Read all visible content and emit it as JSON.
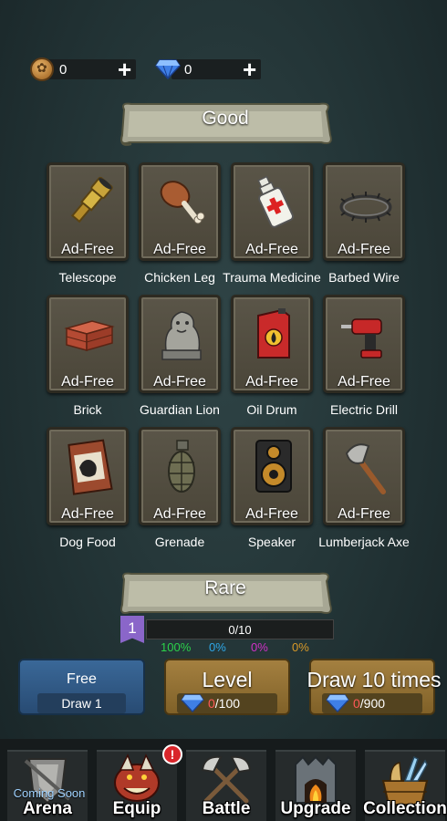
{
  "currency": {
    "coins": {
      "icon": "coin-icon",
      "value": "0",
      "add": "+"
    },
    "gems": {
      "icon": "diamond-icon",
      "value": "0",
      "add": "+"
    }
  },
  "good_banner": "Good",
  "rare_banner": "Rare",
  "items": [
    {
      "label": "Ad-Free",
      "name": "Telescope",
      "icon": "telescope-icon"
    },
    {
      "label": "Ad-Free",
      "name": "Chicken Leg",
      "icon": "chicken-leg-icon"
    },
    {
      "label": "Ad-Free",
      "name": "Trauma Medicine",
      "icon": "medicine-bottle-icon"
    },
    {
      "label": "Ad-Free",
      "name": "Barbed Wire",
      "icon": "barbed-wire-icon"
    },
    {
      "label": "Ad-Free",
      "name": "Brick",
      "icon": "brick-icon"
    },
    {
      "label": "Ad-Free",
      "name": "Guardian Lion",
      "icon": "lion-statue-icon"
    },
    {
      "label": "Ad-Free",
      "name": "Oil Drum",
      "icon": "oil-drum-icon"
    },
    {
      "label": "Ad-Free",
      "name": "Electric Drill",
      "icon": "drill-icon"
    },
    {
      "label": "Ad-Free",
      "name": "Dog Food",
      "icon": "dog-food-icon"
    },
    {
      "label": "Ad-Free",
      "name": "Grenade",
      "icon": "grenade-icon"
    },
    {
      "label": "Ad-Free",
      "name": "Speaker",
      "icon": "speaker-icon"
    },
    {
      "label": "Ad-Free",
      "name": "Lumberjack Axe",
      "icon": "axe-icon"
    }
  ],
  "progress": {
    "level": "1",
    "text": "0/10",
    "fill": 0
  },
  "percentages": [
    {
      "value": "100%",
      "color": "#2bd24a"
    },
    {
      "value": "0%",
      "color": "#2ea8e8"
    },
    {
      "value": "0%",
      "color": "#d230c8"
    },
    {
      "value": "0%",
      "color": "#d99a28"
    }
  ],
  "buttons": {
    "free": {
      "label": "Free",
      "sub": "Draw 1"
    },
    "level": {
      "label": "Level",
      "cost_have": "0",
      "cost_need": "/100"
    },
    "draw10": {
      "label": "Draw 10 times",
      "cost_have": "0",
      "cost_need": "/900"
    }
  },
  "nav": {
    "arena": {
      "label": "Arena",
      "note": "Coming Soon",
      "icon": "arena-shield-icon"
    },
    "equip": {
      "label": "Equip",
      "badge": "!",
      "icon": "equip-creature-icon"
    },
    "battle": {
      "label": "Battle",
      "icon": "crossed-axes-icon"
    },
    "upgrade": {
      "label": "Upgrade",
      "icon": "forge-icon"
    },
    "collection": {
      "label": "Collection",
      "icon": "collection-basket-icon"
    }
  }
}
